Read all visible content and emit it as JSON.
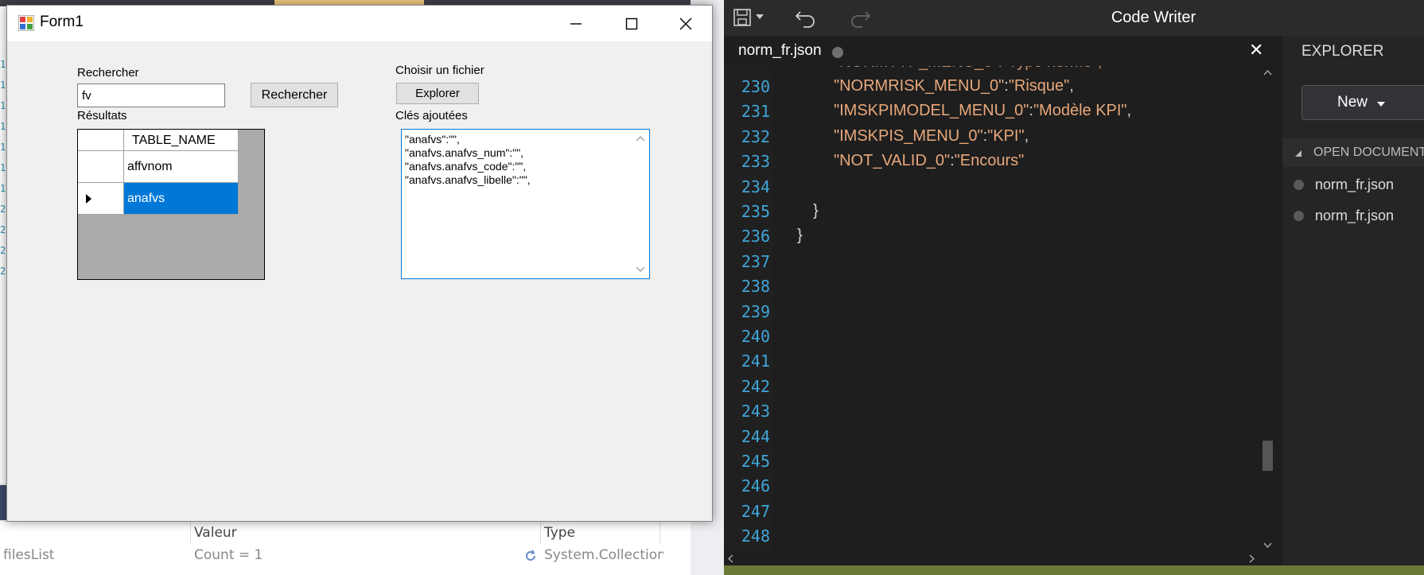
{
  "vs_background": {
    "line_digits": [
      "1",
      "1",
      "1",
      "1",
      "1",
      "1",
      "1",
      "2",
      "2",
      "2",
      "2"
    ],
    "locals_headers": [
      "Valeur",
      "Type"
    ],
    "locals_row": {
      "name": "filesList",
      "value": "Count = 1",
      "type": "System.Collection:"
    }
  },
  "form": {
    "title": "Form1",
    "search_label": "Rechercher",
    "search_value": "fv",
    "search_button": "Rechercher",
    "results_label": "Résultats",
    "grid": {
      "column_header": "TABLE_NAME",
      "rows": [
        "affvnom",
        "anafvs"
      ],
      "selected_row": 1
    },
    "file_label": "Choisir un fichier",
    "browse_button": "Explorer",
    "keys_label": "Clés ajoutées",
    "keys_lines": [
      "\"anafvs\":\"\",",
      "\"anafvs.anafvs_num\":\"\",",
      "\"anafvs.anafvs_code\":\"\",",
      "\"anafvs.anafvs_libelle\":\"\","
    ]
  },
  "code_writer": {
    "app_title": "Code Writer",
    "tab_label": "norm_fr.json",
    "line_numbers": [
      "230",
      "231",
      "232",
      "233",
      "234",
      "235",
      "236",
      "237",
      "238",
      "239",
      "240",
      "241",
      "242",
      "243",
      "244",
      "245",
      "246",
      "247",
      "248"
    ],
    "code_lines": [
      {
        "key": "\"NORMRISK_MENU_0\"",
        "value": "\"Risque\"",
        "trail": ","
      },
      {
        "key": "\"IMSKPIMODEL_MENU_0\"",
        "value": "\"Modèle KPI\"",
        "trail": ","
      },
      {
        "key": "\"IMSKPIS_MENU_0\"",
        "value": "\"KPI\"",
        "trail": ","
      },
      {
        "key": "\"NOT_VALID_0\"",
        "value": "\"Encours\"",
        "trail": ""
      }
    ],
    "close_braces": [
      "}",
      "}"
    ],
    "explorer": {
      "title": "EXPLORER",
      "new_button": "New",
      "section_label": "OPEN DOCUMENTS",
      "documents": [
        "norm_fr.json",
        "norm_fr.json"
      ]
    },
    "colors": {
      "line_number": "#40a6d9",
      "string": "#e8a87c",
      "status_bar": "#6a7a36"
    }
  }
}
